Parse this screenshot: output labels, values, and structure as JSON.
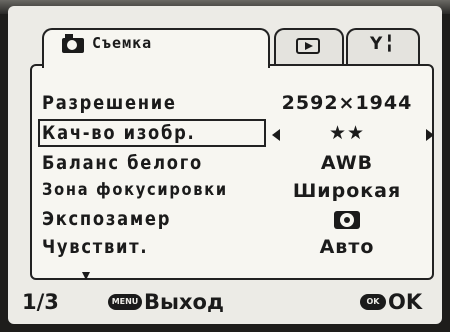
{
  "tabs": [
    {
      "label": "Съемка",
      "icon": "camera-icon"
    },
    {
      "label": "",
      "icon": "playback-icon"
    },
    {
      "label": "",
      "icon": "setup-icon"
    }
  ],
  "setup_tab_glyph": "Y╏",
  "menu": {
    "rows": [
      {
        "label": "Разрешение",
        "value": "2592×1944"
      },
      {
        "label": "Кач-во изобр.",
        "value": "★★"
      },
      {
        "label": "Баланс белого",
        "value": "AWB"
      },
      {
        "label": "Зона фокусировки",
        "value": "Широкая"
      },
      {
        "label": "Экспозамер",
        "value": "",
        "value_icon": "metering-icon"
      },
      {
        "label": "Чувствит.",
        "value": "Авто"
      }
    ]
  },
  "footer": {
    "page": "1/3",
    "menu_key": "MENU",
    "exit_label": "Выход",
    "ok_key": "OK",
    "ok_label": "OK"
  }
}
